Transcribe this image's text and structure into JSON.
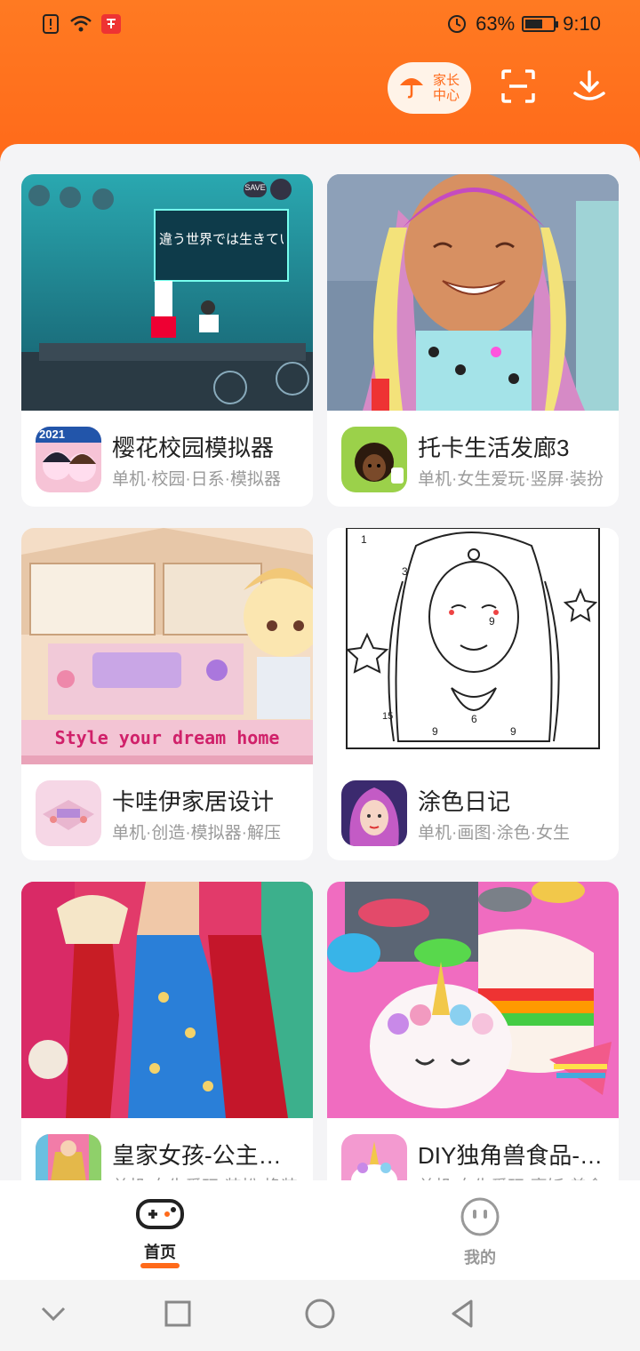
{
  "status_bar": {
    "battery_percent": "63%",
    "time": "9:10",
    "battery_level": 0.63
  },
  "header": {
    "parent_center_label": "家长中心"
  },
  "games": [
    {
      "title": "樱花校园模拟器",
      "tags": "单机·校园·日系·模拟器",
      "icon_badge": "2021",
      "cover_text": "違う世界では生きている",
      "cover_buttons": [
        "SAVE"
      ]
    },
    {
      "title": "托卡生活发廊3",
      "tags": "单机·女生爱玩·竖屏·装扮"
    },
    {
      "title": "卡哇伊家居设计",
      "tags": "单机·创造·模拟器·解压",
      "cover_text": "Style your dream home"
    },
    {
      "title": "涂色日记",
      "tags": "单机·画图·涂色·女生",
      "cover_numbers": [
        "1",
        "3",
        "9",
        "6",
        "9",
        "9",
        "15"
      ]
    },
    {
      "title": "皇家女孩-公主换装",
      "tags": "单机·女生爱玩·装扮·换装"
    },
    {
      "title": "DIY独角兽食品-蛋糕",
      "tags": "单机·女生爱玩·烹饪·美食"
    }
  ],
  "tabs": [
    {
      "label": "首页",
      "active": true
    },
    {
      "label": "我的",
      "active": false
    }
  ],
  "colors": {
    "accent": "#ff6a1a",
    "background": "#f4f4f6"
  }
}
